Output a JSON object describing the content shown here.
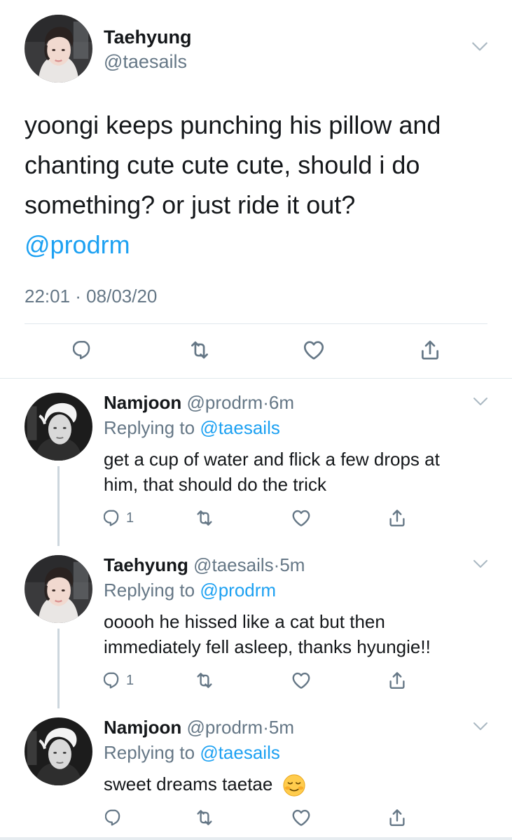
{
  "main_tweet": {
    "name": "Taehyung",
    "handle": "@taesails",
    "text_line1": "yoongi keeps punching his pillow and",
    "text_line2": "chanting cute cute cute, should i do",
    "text_line3": "something? or just ride it out?",
    "mention": "@prodrm",
    "timestamp": "22:01 · 08/03/20",
    "avatar_icon": "avatar-taehyung",
    "actions": [
      "reply-icon",
      "retweet-icon",
      "like-icon",
      "share-icon"
    ]
  },
  "replies": [
    {
      "name": "Namjoon",
      "handle": "@prodrm",
      "separator": "·",
      "time": "6m",
      "replying_prefix": "Replying to ",
      "replying_to": "@taesails",
      "text_line1": "get a cup of water and flick a few drops at",
      "text_line2": "him, that should do the trick",
      "reply_count": "1",
      "avatar_icon": "avatar-namjoon"
    },
    {
      "name": "Taehyung",
      "handle": "@taesails",
      "separator": "·",
      "time": "5m",
      "replying_prefix": "Replying to ",
      "replying_to": "@prodrm",
      "text_line1": "ooooh he hissed like a cat but then",
      "text_line2": "immediately fell asleep, thanks hyungie!!",
      "reply_count": "1",
      "avatar_icon": "avatar-taehyung"
    },
    {
      "name": "Namjoon",
      "handle": "@prodrm",
      "separator": "·",
      "time": "5m",
      "replying_prefix": "Replying to ",
      "replying_to": "@taesails",
      "text_line1": "sweet dreams taetae",
      "emoji": "relieved-smiling-face-emoji",
      "reply_count": "",
      "avatar_icon": "avatar-namjoon"
    }
  ],
  "colors": {
    "text": "#14171a",
    "secondary": "#657786",
    "link": "#1da1f2",
    "divider": "#e1e8ed",
    "icon": "#657786"
  }
}
